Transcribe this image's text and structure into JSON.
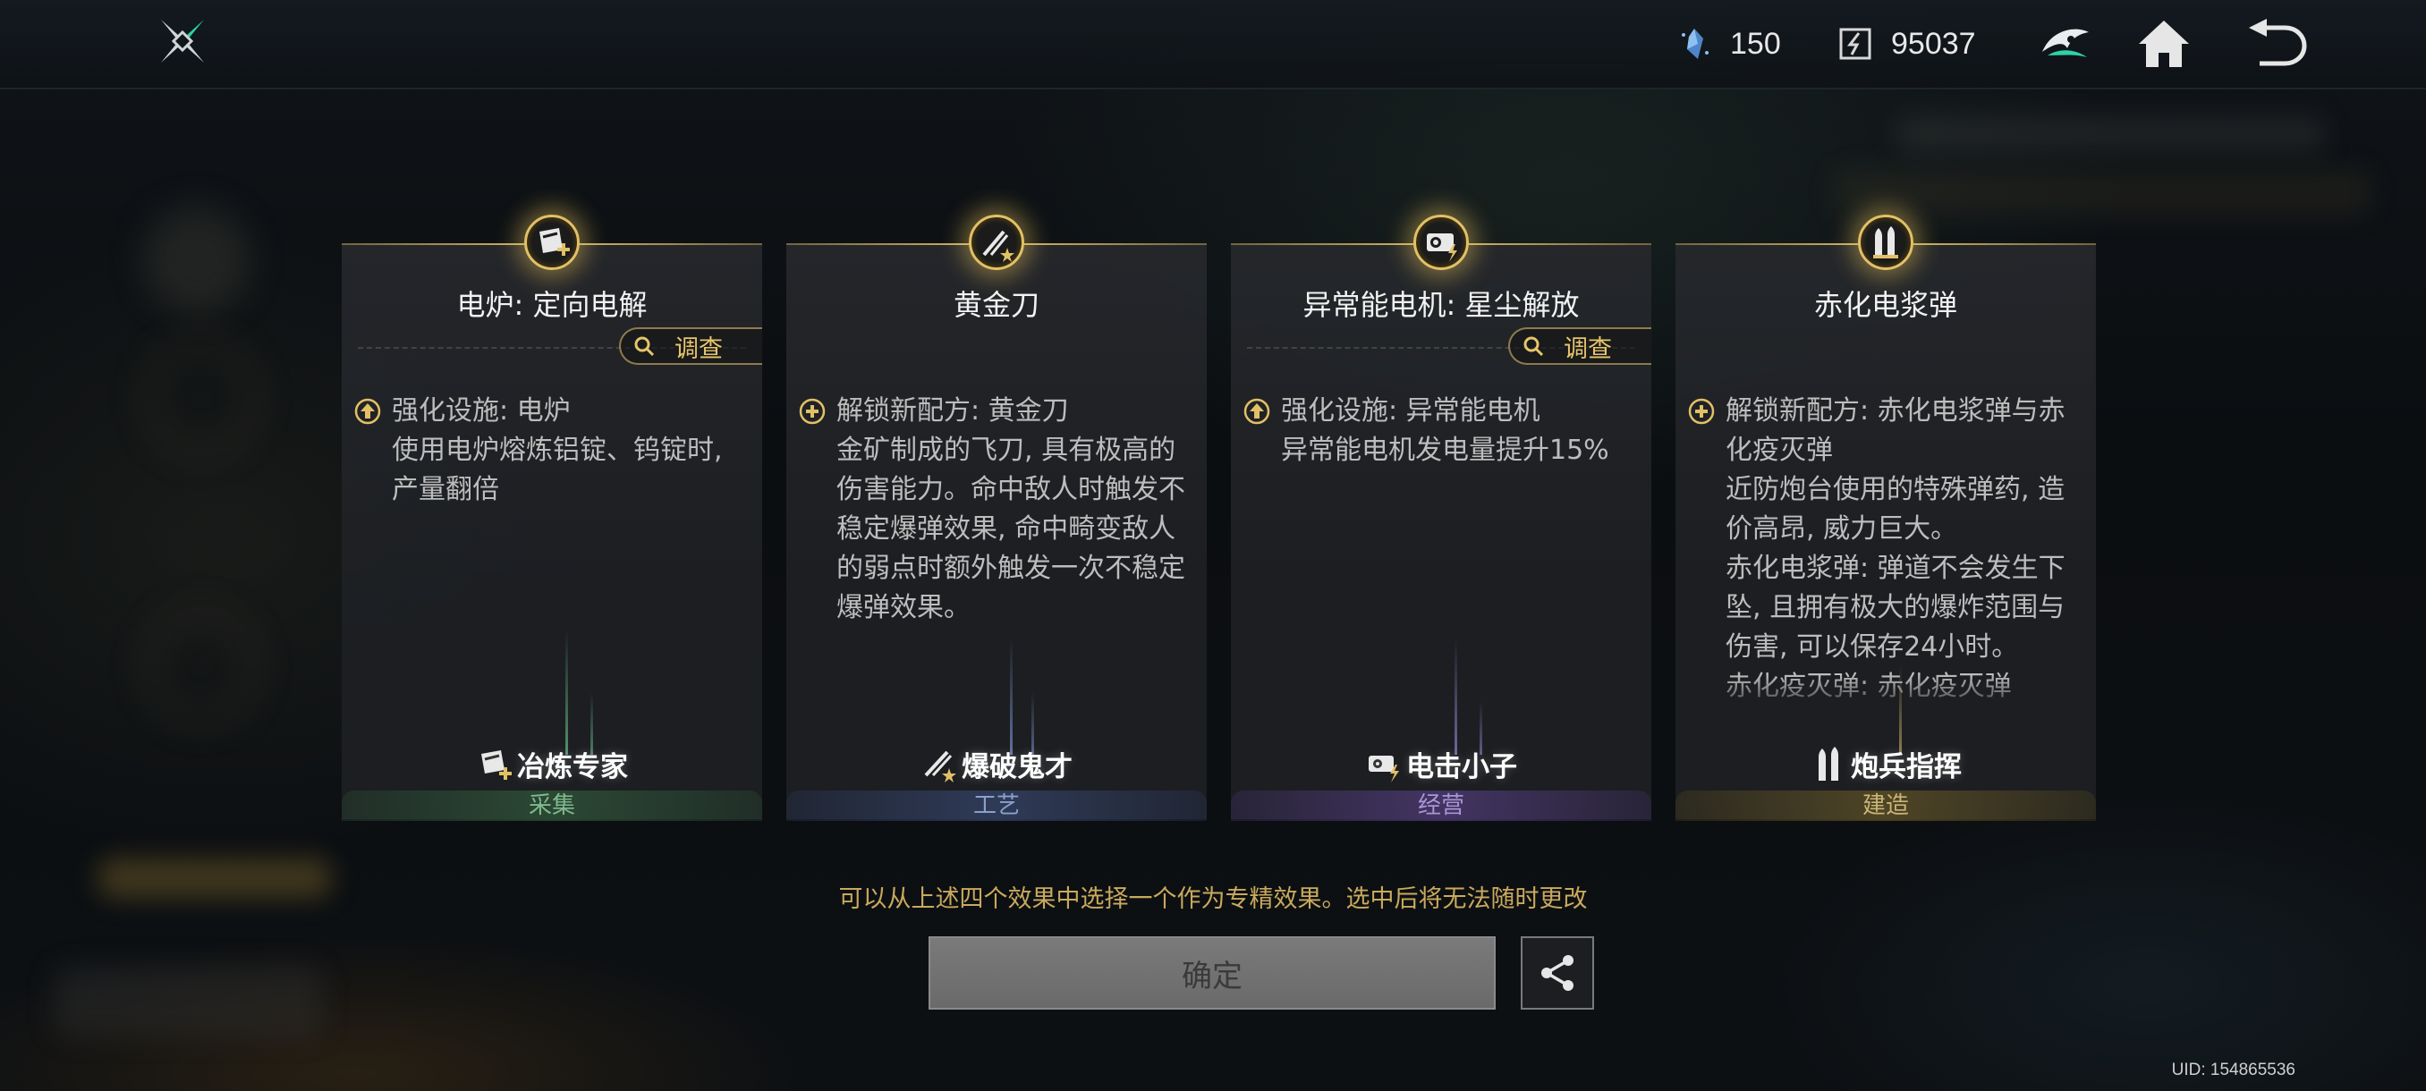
{
  "topbar": {
    "energy": "150",
    "currency": "95037",
    "icons": [
      "game-logo-icon",
      "energy-crystal-icon",
      "currency-chip-icon",
      "faction-emblem-icon",
      "home-icon",
      "back-arrow-icon"
    ]
  },
  "labels": {
    "investigate": "调查"
  },
  "cards": [
    {
      "title": "电炉: 定向电解",
      "effect": "强化设施: 电炉\n使用电炉熔炼铝锭、钨锭时, 产量翻倍",
      "specialist": "冶炼专家",
      "category": "采集",
      "has_investigate": true
    },
    {
      "title": "黄金刀",
      "effect": "解锁新配方: 黄金刀\n金矿制成的飞刀, 具有极高的伤害能力。命中敌人时触发不稳定爆弹效果, 命中畸变敌人的弱点时额外触发一次不稳定爆弹效果。",
      "specialist": "爆破鬼才",
      "category": "工艺",
      "has_investigate": false
    },
    {
      "title": "异常能电机: 星尘解放",
      "effect": "强化设施: 异常能电机\n异常能电机发电量提升15%",
      "specialist": "电击小子",
      "category": "经营",
      "has_investigate": true
    },
    {
      "title": "赤化电浆弹",
      "effect": "解锁新配方: 赤化电浆弹与赤化疫灭弹\n近防炮台使用的特殊弹药, 造价高昂, 威力巨大。\n赤化电浆弹: 弹道不会发生下坠, 且拥有极大的爆炸范围与伤害, 可以保存24小时。\n赤化疫灭弹: 赤化疫灭弹",
      "specialist": "炮兵指挥",
      "category": "建造",
      "has_investigate": false
    }
  ],
  "footer": {
    "hint": "可以从上述四个效果中选择一个作为专精效果。选中后将无法随时更改",
    "confirm": "确定",
    "uid": "UID: 154865536"
  },
  "colors": {
    "accent_gold": "#e2c066",
    "hint_gold": "#c9a95d",
    "category_gather": "#7fb98f",
    "category_craft": "#8aa0cc",
    "category_manage": "#a796d6",
    "category_build": "#c9b574",
    "confirm_disabled": "#737373"
  }
}
